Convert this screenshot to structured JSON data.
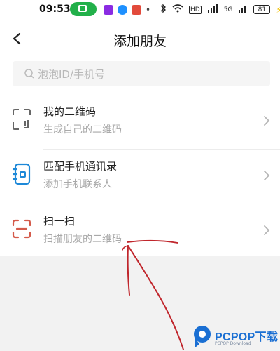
{
  "status_bar": {
    "time": "09:53",
    "network_badge": "HD",
    "signal_label": "5G",
    "battery": "81"
  },
  "header": {
    "title": "添加朋友"
  },
  "search": {
    "placeholder": "泡泡ID/手机号"
  },
  "rows": [
    {
      "title": "我的二维码",
      "subtitle": "生成自己的二维码",
      "icon": "qr-code-icon"
    },
    {
      "title": "匹配手机通讯录",
      "subtitle": "添加手机联系人",
      "icon": "contacts-book-icon"
    },
    {
      "title": "扫一扫",
      "subtitle": "扫描朋友的二维码",
      "icon": "scan-icon"
    }
  ],
  "watermark": {
    "brand": "PCPOP下载",
    "sub": "PCPOP Download"
  },
  "colors": {
    "accent_blue": "#1d88d8",
    "scan_red": "#d45a4a",
    "annotation_red": "#c0262c",
    "status_green": "#22b04a"
  }
}
